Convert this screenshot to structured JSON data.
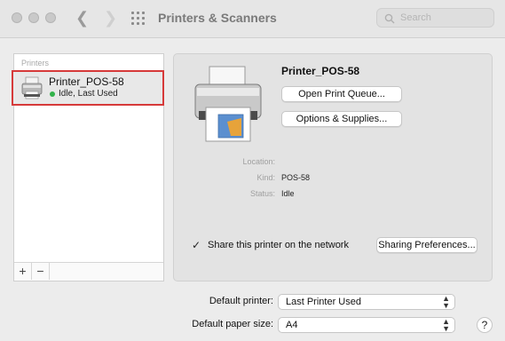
{
  "window": {
    "title": "Printers & Scanners",
    "search_placeholder": "Search"
  },
  "printers_list": {
    "header": "Printers",
    "items": [
      {
        "name": "Printer_POS-58",
        "status": "Idle, Last Used",
        "status_color": "#32b24a",
        "selected": true
      }
    ],
    "add_label": "+",
    "remove_label": "−"
  },
  "detail": {
    "name": "Printer_POS-58",
    "open_queue_label": "Open Print Queue...",
    "options_label": "Options & Supplies...",
    "location_label": "Location:",
    "location_value": "",
    "kind_label": "Kind:",
    "kind_value": "POS-58",
    "status_label": "Status:",
    "status_value": "Idle",
    "share_label": "Share this printer on the network",
    "share_checked": true,
    "sharing_prefs_label": "Sharing Preferences..."
  },
  "defaults": {
    "printer_label": "Default printer:",
    "printer_value": "Last Printer Used",
    "paper_label": "Default paper size:",
    "paper_value": "A4"
  },
  "help_label": "?",
  "colors": {
    "selection_border": "#d63a3a",
    "window_bg": "#ececec"
  }
}
